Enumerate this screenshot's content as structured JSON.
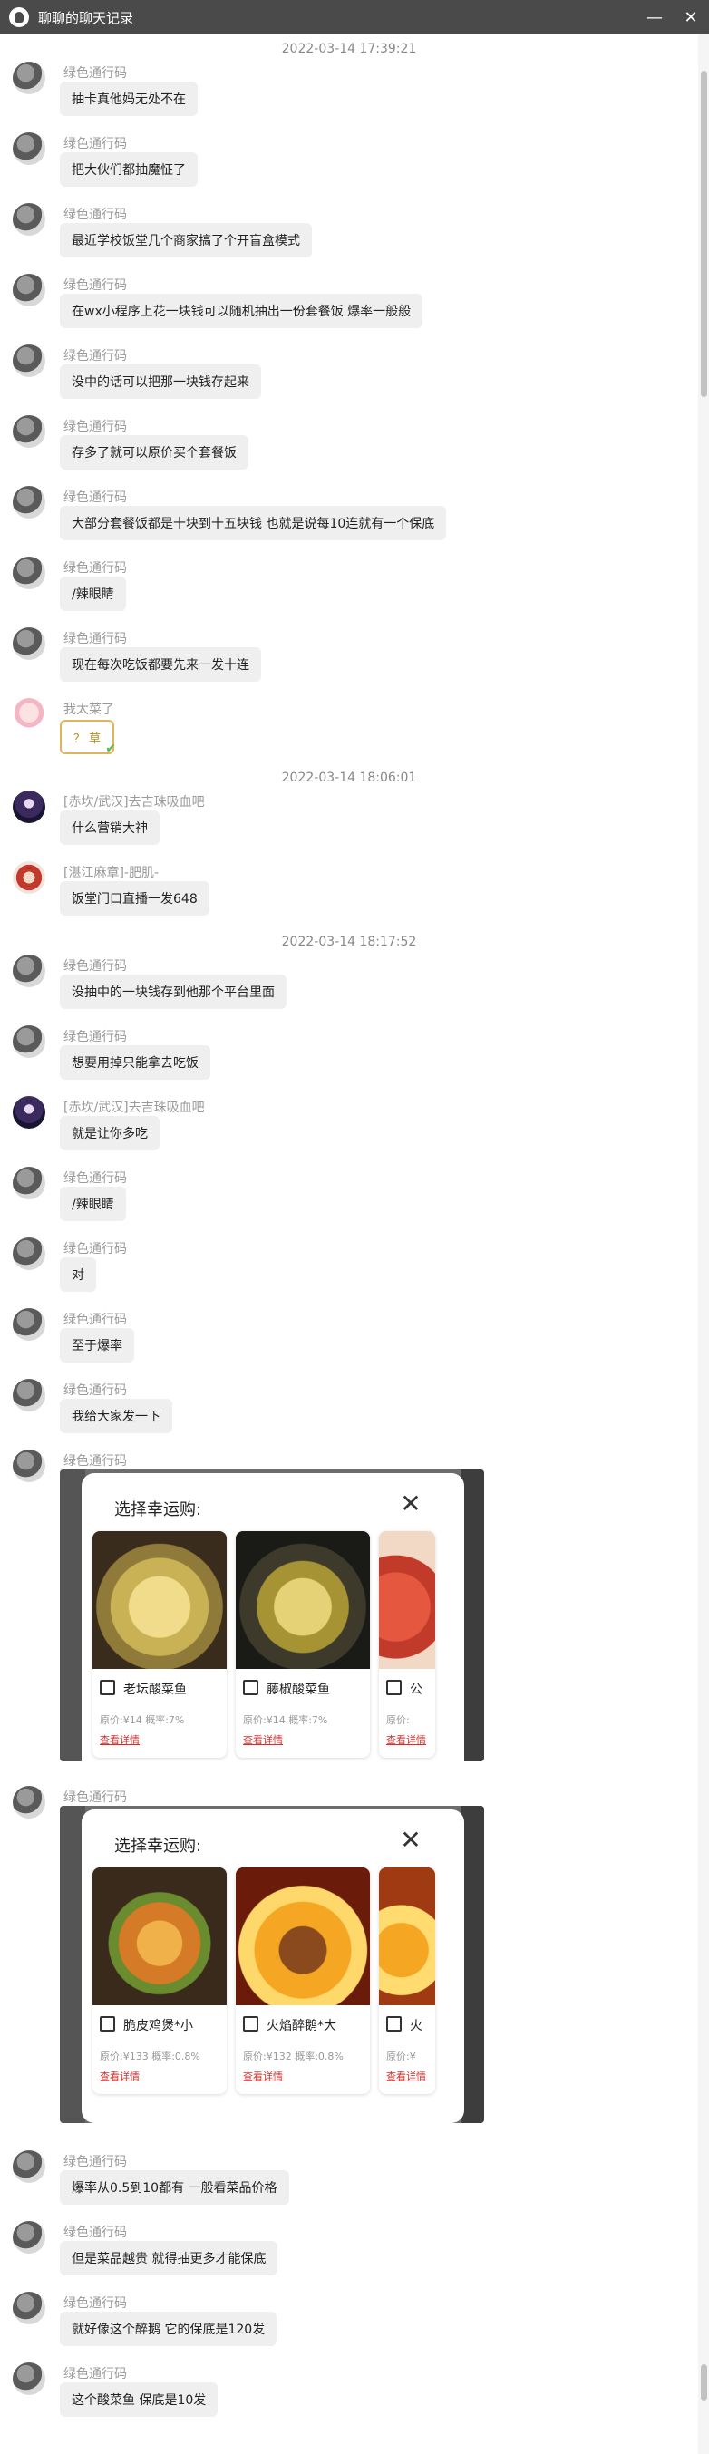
{
  "window": {
    "title": "聊聊的聊天记录",
    "minimize_glyph": "—",
    "close_glyph": "✕"
  },
  "timestamps": [
    "2022-03-14 17:39:21",
    "2022-03-14 18:06:01",
    "2022-03-14 18:17:52"
  ],
  "messages": [
    {
      "sender": "绿色通行码",
      "text": "抽卡真他妈无处不在"
    },
    {
      "sender": "绿色通行码",
      "text": "把大伙们都抽魔怔了"
    },
    {
      "sender": "绿色通行码",
      "text": "最近学校饭堂几个商家搞了个开盲盒模式"
    },
    {
      "sender": "绿色通行码",
      "text": "在wx小程序上花一块钱可以随机抽出一份套餐饭 爆率一般般"
    },
    {
      "sender": "绿色通行码",
      "text": "没中的话可以把那一块钱存起来"
    },
    {
      "sender": "绿色通行码",
      "text": "存多了就可以原价买个套餐饭"
    },
    {
      "sender": "绿色通行码",
      "text": "大部分套餐饭都是十块到十五块钱 也就是说每10连就有一个保底"
    },
    {
      "sender": "绿色通行码",
      "text": "/辣眼睛"
    },
    {
      "sender": "绿色通行码",
      "text": "现在每次吃饭都要先来一发十连"
    },
    {
      "sender": "我太菜了",
      "sticker": "？ 草"
    },
    {
      "sender": "[赤坎/武汉]去吉珠吸血吧",
      "text": "什么营销大神"
    },
    {
      "sender": "[湛江麻章]-肥肌-",
      "text": "饭堂门口直播一发648"
    },
    {
      "sender": "绿色通行码",
      "text": "没抽中的一块钱存到他那个平台里面"
    },
    {
      "sender": "绿色通行码",
      "text": "想要用掉只能拿去吃饭"
    },
    {
      "sender": "[赤坎/武汉]去吉珠吸血吧",
      "text": "就是让你多吃"
    },
    {
      "sender": "绿色通行码",
      "text": "/辣眼睛"
    },
    {
      "sender": "绿色通行码",
      "text": "对"
    },
    {
      "sender": "绿色通行码",
      "text": "至于爆率"
    },
    {
      "sender": "绿色通行码",
      "text": "我给大家发一下"
    },
    {
      "sender": "绿色通行码"
    },
    {
      "sender": "绿色通行码"
    },
    {
      "sender": "绿色通行码",
      "text": "爆率从0.5到10都有 一般看菜品价格"
    },
    {
      "sender": "绿色通行码",
      "text": "但是菜品越贵 就得抽更多才能保底"
    },
    {
      "sender": "绿色通行码",
      "text": "就好像这个醉鹅 它的保底是120发"
    },
    {
      "sender": "绿色通行码",
      "text": "这个酸菜鱼 保底是10发"
    }
  ],
  "shots": [
    {
      "title": "选择幸运购:",
      "close_glyph": "✕",
      "cards": [
        {
          "name": "老坛酸菜鱼",
          "price": "原价:¥14 概率:7%",
          "link": "查看详情"
        },
        {
          "name": "藤椒酸菜鱼",
          "price": "原价:¥14 概率:7%",
          "link": "查看详情"
        },
        {
          "name": "公",
          "price": "原价:",
          "link": "查看详情"
        }
      ]
    },
    {
      "title": "选择幸运购:",
      "close_glyph": "✕",
      "cards": [
        {
          "name": "脆皮鸡煲*小",
          "price": "原价:¥133 概率:0.8%",
          "link": "查看详情"
        },
        {
          "name": "火焰醉鹅*大",
          "price": "原价:¥132 概率:0.8%",
          "link": "查看详情"
        },
        {
          "name": "火",
          "price": "原价:¥",
          "link": "查看详情"
        }
      ]
    }
  ]
}
